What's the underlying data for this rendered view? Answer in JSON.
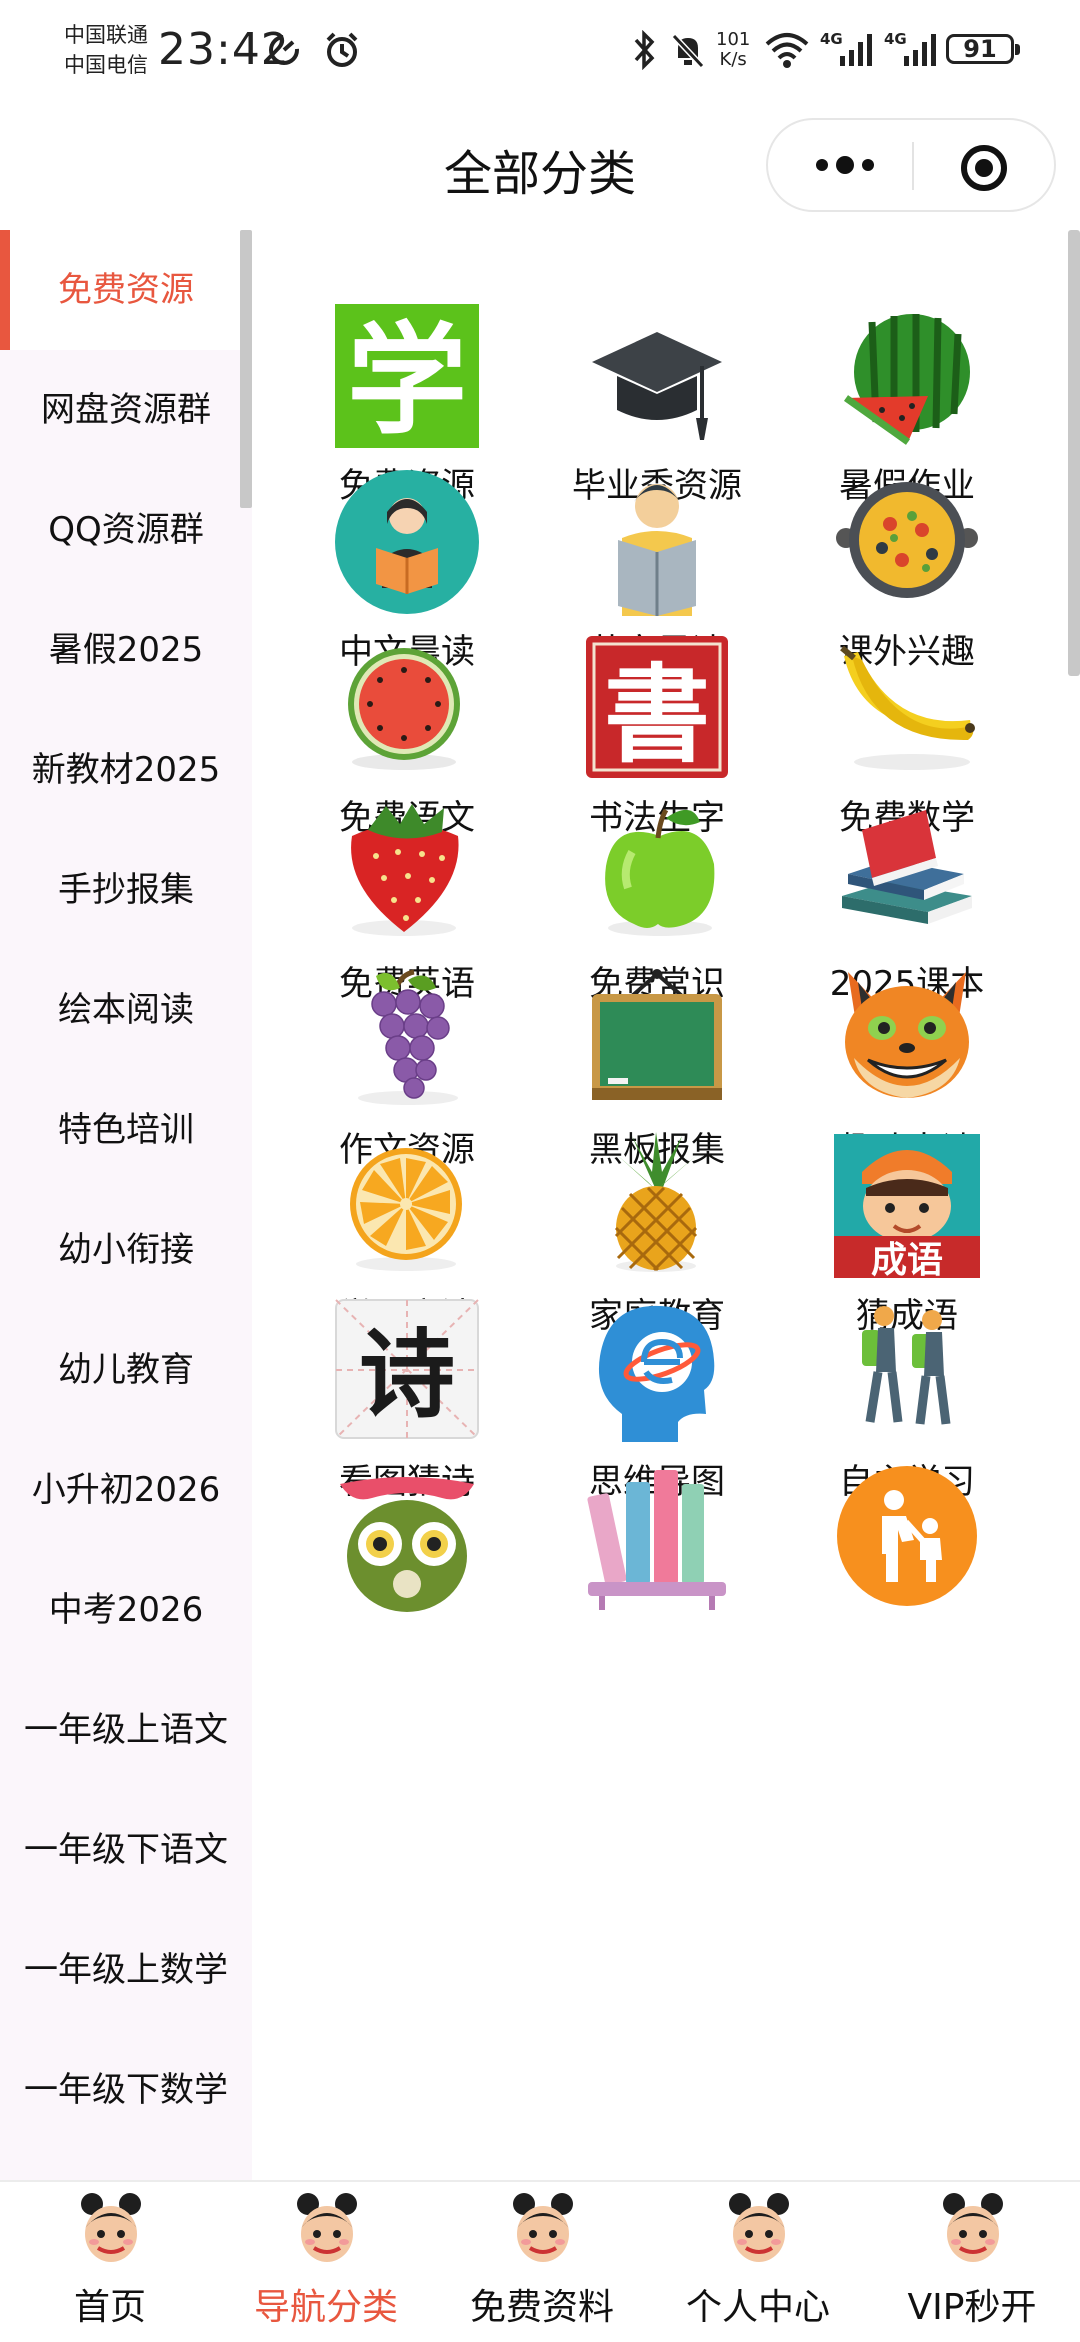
{
  "status_bar": {
    "carrier1": "中国联通",
    "carrier2": "中国电信",
    "time": "23:42",
    "net_speed_value": "101",
    "net_speed_unit": "K/s",
    "sig1_label": "4G",
    "sig2_label": "4G",
    "battery": "91"
  },
  "nav": {
    "title": "全部分类"
  },
  "sidebar": {
    "items": [
      {
        "label": "免费资源"
      },
      {
        "label": "网盘资源群"
      },
      {
        "label": "QQ资源群"
      },
      {
        "label": "暑假2025"
      },
      {
        "label": "新教材2025"
      },
      {
        "label": "手抄报集"
      },
      {
        "label": "绘本阅读"
      },
      {
        "label": "特色培训"
      },
      {
        "label": "幼小衔接"
      },
      {
        "label": "幼儿教育"
      },
      {
        "label": "小升初2026"
      },
      {
        "label": "中考2026"
      },
      {
        "label": "一年级上语文"
      },
      {
        "label": "一年级下语文"
      },
      {
        "label": "一年级上数学"
      },
      {
        "label": "一年级下数学"
      }
    ]
  },
  "grid": {
    "items": [
      {
        "label": "免费资源",
        "icon": "xue-character-icon"
      },
      {
        "label": "毕业季资源",
        "icon": "graduation-cap-icon"
      },
      {
        "label": "暑假作业",
        "icon": "watermelon-icon"
      },
      {
        "label": "中文晨读",
        "icon": "reading-girl-icon"
      },
      {
        "label": "英文晨读",
        "icon": "reading-boy-icon"
      },
      {
        "label": "课外兴趣",
        "icon": "paella-pan-icon"
      },
      {
        "label": "免费语文",
        "icon": "watermelon-slice-icon"
      },
      {
        "label": "书法生字",
        "icon": "shu-character-icon"
      },
      {
        "label": "免费数学",
        "icon": "banana-icon"
      },
      {
        "label": "免费英语",
        "icon": "strawberry-icon"
      },
      {
        "label": "免费常识",
        "icon": "green-apple-icon"
      },
      {
        "label": "2025课本",
        "icon": "books-stack-icon"
      },
      {
        "label": "作文资源",
        "icon": "grapes-icon"
      },
      {
        "label": "黑板报集",
        "icon": "chalkboard-icon"
      },
      {
        "label": "趣味古诗",
        "icon": "fox-icon"
      },
      {
        "label": "学习方法",
        "icon": "orange-slice-icon"
      },
      {
        "label": "家庭教育",
        "icon": "pineapple-icon"
      },
      {
        "label": "猜成语",
        "icon": "chengyu-boy-icon"
      },
      {
        "label": "看图猜诗",
        "icon": "shi-character-icon"
      },
      {
        "label": "思维导图",
        "icon": "mind-map-head-icon"
      },
      {
        "label": "自主学习",
        "icon": "walking-students-icon"
      },
      {
        "label": "",
        "icon": "owl-icon"
      },
      {
        "label": "",
        "icon": "bookshelf-icon"
      },
      {
        "label": "",
        "icon": "parent-child-icon"
      }
    ]
  },
  "tabbar": {
    "items": [
      {
        "label": "首页"
      },
      {
        "label": "导航分类"
      },
      {
        "label": "免费资料"
      },
      {
        "label": "个人中心"
      },
      {
        "label": "VIP秒开"
      }
    ]
  },
  "colors": {
    "accent": "#e8573f",
    "sidebar_bg": "#fbf6fb"
  }
}
